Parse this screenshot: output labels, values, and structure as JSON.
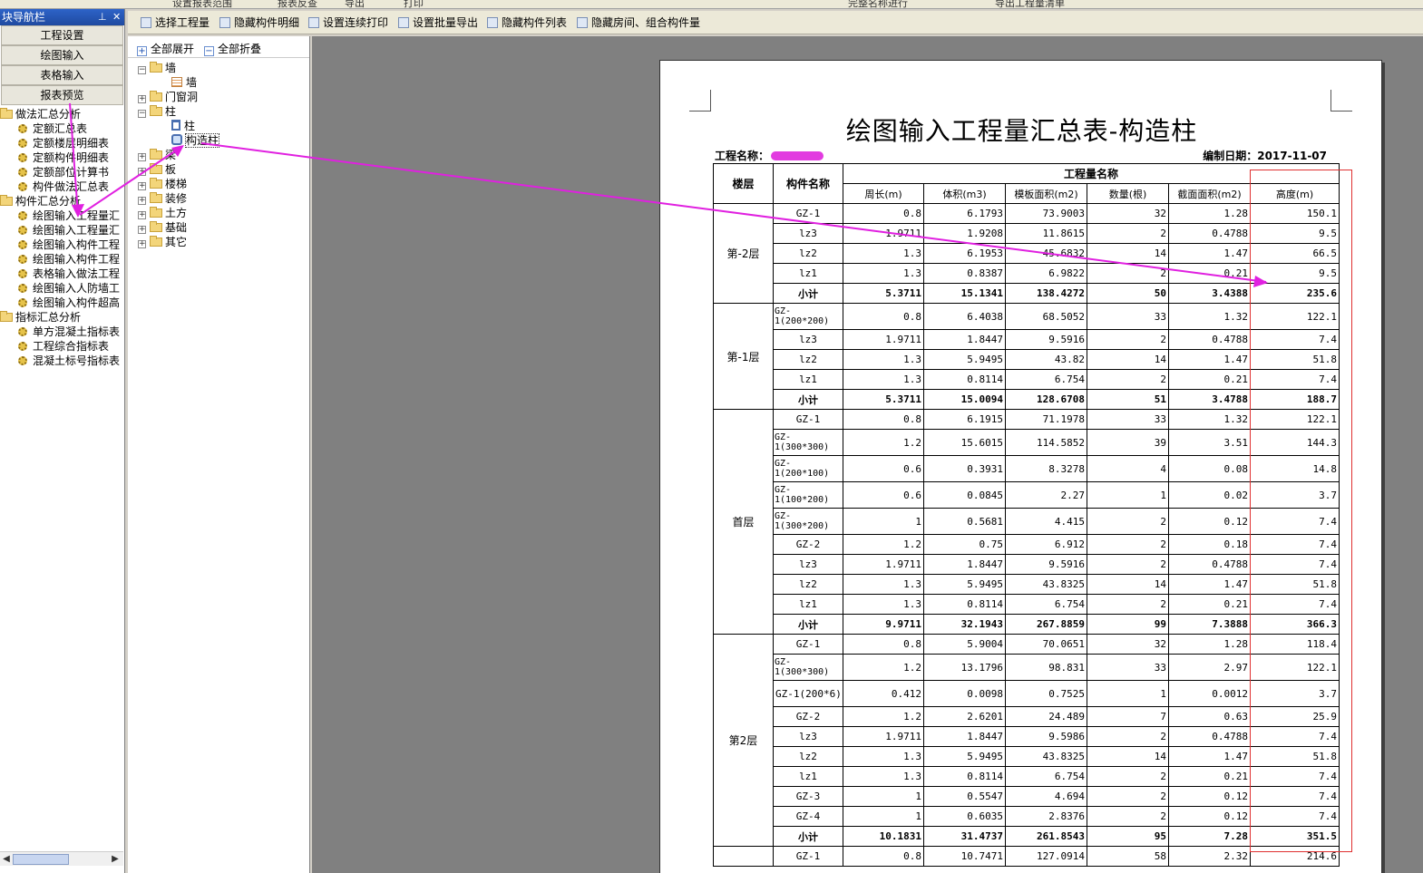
{
  "top_toolbar": {
    "items": [
      "设置报表范围",
      "报表反查",
      "导出",
      "打印",
      "完整名称进行",
      "导出工程量清单"
    ]
  },
  "nav": {
    "title": "块导航栏",
    "pin_icon": "pin-icon",
    "close_icon": "close-icon",
    "buttons": [
      "工程设置",
      "绘图输入",
      "表格输入",
      "报表预览"
    ],
    "groups": [
      {
        "label": "做法汇总分析",
        "items": [
          "定额汇总表",
          "定额楼层明细表",
          "定额构件明细表",
          "定额部位计算书",
          "构件做法汇总表"
        ]
      },
      {
        "label": "构件汇总分析",
        "items": [
          "绘图输入工程量汇",
          "绘图输入工程量汇",
          "绘图输入构件工程",
          "绘图输入构件工程",
          "表格输入做法工程",
          "绘图输入人防墙工",
          "绘图输入构件超高"
        ]
      },
      {
        "label": "指标汇总分析",
        "items": [
          "单方混凝土指标表",
          "工程综合指标表",
          "混凝土标号指标表"
        ]
      }
    ]
  },
  "toolbar": {
    "items": [
      "选择工程量",
      "隐藏构件明细",
      "设置连续打印",
      "设置批量导出",
      "隐藏构件列表",
      "隐藏房间、组合构件量"
    ]
  },
  "tree": {
    "expand_all": "全部展开",
    "collapse_all": "全部折叠",
    "items": {
      "wall": "墙",
      "wall_child": "墙",
      "door": "门窗洞",
      "col": "柱",
      "col_child": "柱",
      "gzz": "构造柱",
      "beam": "梁",
      "slab": "板",
      "stair": "楼梯",
      "decor": "装修",
      "earth": "土方",
      "found": "基础",
      "other": "其它"
    }
  },
  "report": {
    "title": "绘图输入工程量汇总表-构造柱",
    "project_label": "工程名称：",
    "date_label": "编制日期：",
    "date": "2017-11-07",
    "headers": {
      "floor": "楼层",
      "component": "构件名称",
      "quantity_group": "工程量名称",
      "cols": [
        "周长(m)",
        "体积(m3)",
        "模板面积(m2)",
        "数量(根)",
        "截面面积(m2)",
        "高度(m)"
      ]
    },
    "sections": [
      {
        "floor": "第-2层",
        "rows": [
          {
            "name": "GZ-1",
            "v": [
              "0.8",
              "6.1793",
              "73.9003",
              "32",
              "1.28",
              "150.1"
            ]
          },
          {
            "name": "lz3",
            "v": [
              "1.9711",
              "1.9208",
              "11.8615",
              "2",
              "0.4788",
              "9.5"
            ]
          },
          {
            "name": "lz2",
            "v": [
              "1.3",
              "6.1953",
              "45.6832",
              "14",
              "1.47",
              "66.5"
            ]
          },
          {
            "name": "lz1",
            "v": [
              "1.3",
              "0.8387",
              "6.9822",
              "2",
              "0.21",
              "9.5"
            ]
          },
          {
            "name": "小计",
            "v": [
              "5.3711",
              "15.1341",
              "138.4272",
              "50",
              "3.4388",
              "235.6"
            ],
            "sub": true
          }
        ]
      },
      {
        "floor": "第-1层",
        "rows": [
          {
            "name": "GZ-1(200*200)",
            "v": [
              "0.8",
              "6.4038",
              "68.5052",
              "33",
              "1.32",
              "122.1"
            ],
            "wrap": true
          },
          {
            "name": "lz3",
            "v": [
              "1.9711",
              "1.8447",
              "9.5916",
              "2",
              "0.4788",
              "7.4"
            ]
          },
          {
            "name": "lz2",
            "v": [
              "1.3",
              "5.9495",
              "43.82",
              "14",
              "1.47",
              "51.8"
            ]
          },
          {
            "name": "lz1",
            "v": [
              "1.3",
              "0.8114",
              "6.754",
              "2",
              "0.21",
              "7.4"
            ]
          },
          {
            "name": "小计",
            "v": [
              "5.3711",
              "15.0094",
              "128.6708",
              "51",
              "3.4788",
              "188.7"
            ],
            "sub": true
          }
        ]
      },
      {
        "floor": "首层",
        "rows": [
          {
            "name": "GZ-1",
            "v": [
              "0.8",
              "6.1915",
              "71.1978",
              "33",
              "1.32",
              "122.1"
            ]
          },
          {
            "name": "GZ-1(300*300)",
            "v": [
              "1.2",
              "15.6015",
              "114.5852",
              "39",
              "3.51",
              "144.3"
            ],
            "wrap": true
          },
          {
            "name": "GZ-1(200*100)",
            "v": [
              "0.6",
              "0.3931",
              "8.3278",
              "4",
              "0.08",
              "14.8"
            ],
            "wrap": true
          },
          {
            "name": "GZ-1(100*200)",
            "v": [
              "0.6",
              "0.0845",
              "2.27",
              "1",
              "0.02",
              "3.7"
            ],
            "wrap": true
          },
          {
            "name": "GZ-1(300*200)",
            "v": [
              "1",
              "0.5681",
              "4.415",
              "2",
              "0.12",
              "7.4"
            ],
            "wrap": true
          },
          {
            "name": "GZ-2",
            "v": [
              "1.2",
              "0.75",
              "6.912",
              "2",
              "0.18",
              "7.4"
            ]
          },
          {
            "name": "lz3",
            "v": [
              "1.9711",
              "1.8447",
              "9.5916",
              "2",
              "0.4788",
              "7.4"
            ]
          },
          {
            "name": "lz2",
            "v": [
              "1.3",
              "5.9495",
              "43.8325",
              "14",
              "1.47",
              "51.8"
            ]
          },
          {
            "name": "lz1",
            "v": [
              "1.3",
              "0.8114",
              "6.754",
              "2",
              "0.21",
              "7.4"
            ]
          },
          {
            "name": "小计",
            "v": [
              "9.9711",
              "32.1943",
              "267.8859",
              "99",
              "7.3888",
              "366.3"
            ],
            "sub": true
          }
        ]
      },
      {
        "floor": "第2层",
        "rows": [
          {
            "name": "GZ-1",
            "v": [
              "0.8",
              "5.9004",
              "70.0651",
              "32",
              "1.28",
              "118.4"
            ]
          },
          {
            "name": "GZ-1(300*300)",
            "v": [
              "1.2",
              "13.1796",
              "98.831",
              "33",
              "2.97",
              "122.1"
            ],
            "wrap": true
          },
          {
            "name": "GZ-1(200*6)",
            "v": [
              "0.412",
              "0.0098",
              "0.7525",
              "1",
              "0.0012",
              "3.7"
            ],
            "tall": true
          },
          {
            "name": "GZ-2",
            "v": [
              "1.2",
              "2.6201",
              "24.489",
              "7",
              "0.63",
              "25.9"
            ]
          },
          {
            "name": "lz3",
            "v": [
              "1.9711",
              "1.8447",
              "9.5986",
              "2",
              "0.4788",
              "7.4"
            ]
          },
          {
            "name": "lz2",
            "v": [
              "1.3",
              "5.9495",
              "43.8325",
              "14",
              "1.47",
              "51.8"
            ]
          },
          {
            "name": "lz1",
            "v": [
              "1.3",
              "0.8114",
              "6.754",
              "2",
              "0.21",
              "7.4"
            ]
          },
          {
            "name": "GZ-3",
            "v": [
              "1",
              "0.5547",
              "4.694",
              "2",
              "0.12",
              "7.4"
            ]
          },
          {
            "name": "GZ-4",
            "v": [
              "1",
              "0.6035",
              "2.8376",
              "2",
              "0.12",
              "7.4"
            ]
          },
          {
            "name": "小计",
            "v": [
              "10.1831",
              "31.4737",
              "261.8543",
              "95",
              "7.28",
              "351.5"
            ],
            "sub": true
          }
        ]
      },
      {
        "floor": "",
        "rows": [
          {
            "name": "GZ-1",
            "v": [
              "0.8",
              "10.7471",
              "127.0914",
              "58",
              "2.32",
              "214.6"
            ]
          }
        ]
      }
    ]
  },
  "colors": {
    "title_bar": "#1f4aa0",
    "annotation_arrow": "#e020e0",
    "highlight_box": "#e03030",
    "preview_bg": "#808080"
  }
}
